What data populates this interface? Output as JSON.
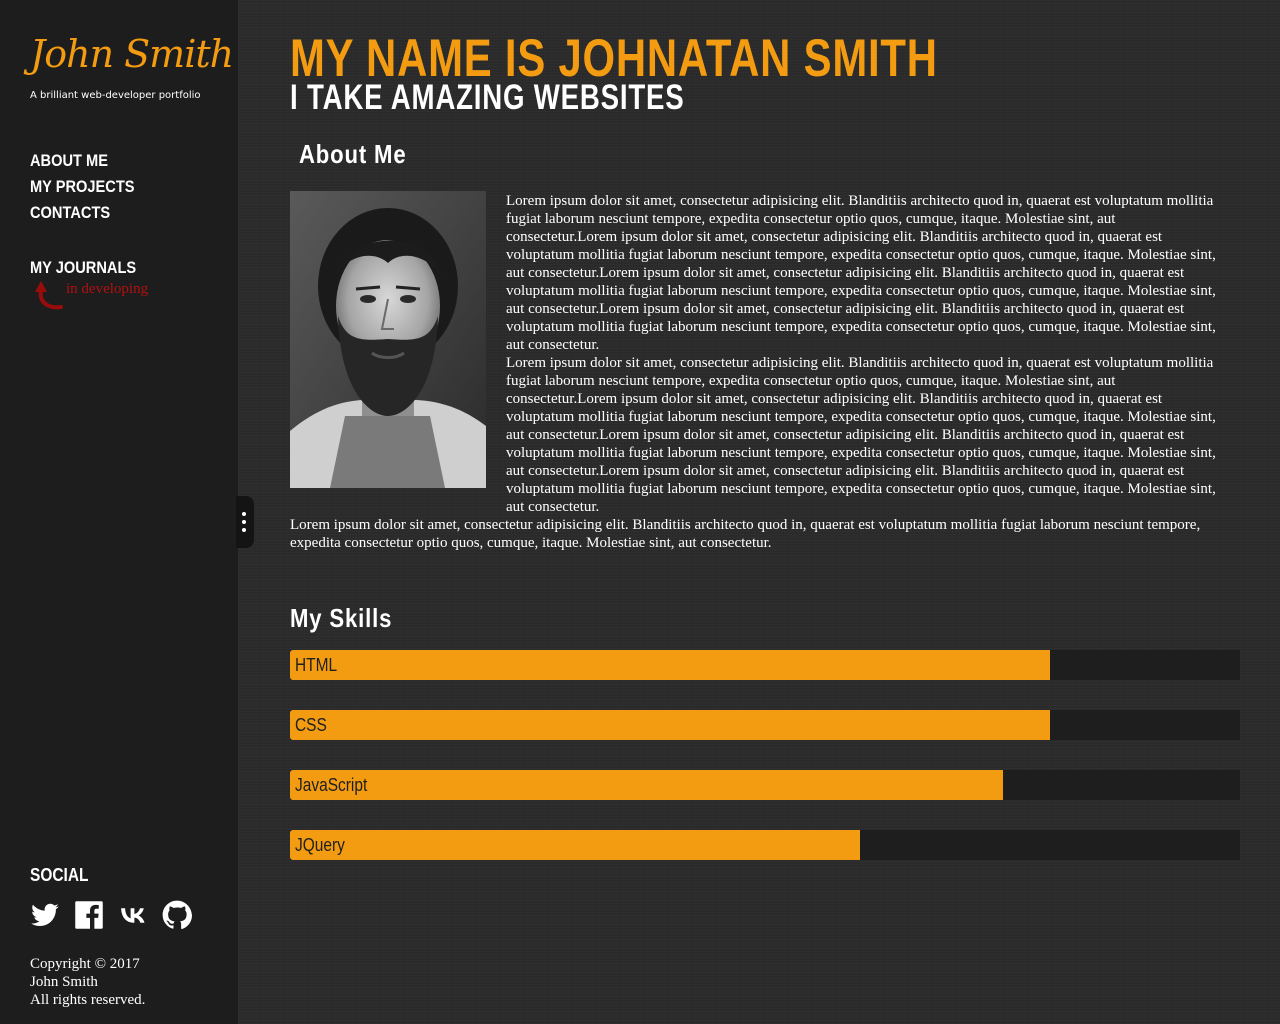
{
  "brand": {
    "logo": "John Smith",
    "tagline": "A brilliant web-developer portfolio"
  },
  "nav": {
    "items": [
      {
        "label": "ABOUT ME"
      },
      {
        "label": "MY PROJECTS"
      },
      {
        "label": "CONTACTS"
      }
    ],
    "journals": "MY JOURNALS",
    "journals_note": "in developing"
  },
  "social": {
    "title": "SOCIAL",
    "icons": [
      "twitter-icon",
      "facebook-icon",
      "vk-icon",
      "github-icon"
    ]
  },
  "copyright": {
    "line1": "Copyright © 2017",
    "line2": "John Smith",
    "line3": "All rights reserved."
  },
  "header": {
    "title": "MY NAME IS JOHNATAN SMITH",
    "subtitle": "I TAKE AMAZING WEBSITES"
  },
  "about": {
    "title": "About Me",
    "paragraphs": [
      "Lorem ipsum dolor sit amet, consectetur adipisicing elit. Blanditiis architecto quod in, quaerat est voluptatum mollitia fugiat laborum nesciunt tempore, expedita consectetur optio quos, cumque, itaque. Molestiae sint, aut consectetur.Lorem ipsum dolor sit amet, consectetur adipisicing elit. Blanditiis architecto quod in, quaerat est voluptatum mollitia fugiat laborum nesciunt tempore, expedita consectetur optio quos, cumque, itaque. Molestiae sint, aut consectetur.Lorem ipsum dolor sit amet, consectetur adipisicing elit. Blanditiis architecto quod in, quaerat est voluptatum mollitia fugiat laborum nesciunt tempore, expedita consectetur optio quos, cumque, itaque. Molestiae sint, aut consectetur.Lorem ipsum dolor sit amet, consectetur adipisicing elit. Blanditiis architecto quod in, quaerat est voluptatum mollitia fugiat laborum nesciunt tempore, expedita consectetur optio quos, cumque, itaque. Molestiae sint, aut consectetur.",
      "Lorem ipsum dolor sit amet, consectetur adipisicing elit. Blanditiis architecto quod in, quaerat est voluptatum mollitia fugiat laborum nesciunt tempore, expedita consectetur optio quos, cumque, itaque. Molestiae sint, aut consectetur.Lorem ipsum dolor sit amet, consectetur adipisicing elit. Blanditiis architecto quod in, quaerat est voluptatum mollitia fugiat laborum nesciunt tempore, expedita consectetur optio quos, cumque, itaque. Molestiae sint, aut consectetur.Lorem ipsum dolor sit amet, consectetur adipisicing elit. Blanditiis architecto quod in, quaerat est voluptatum mollitia fugiat laborum nesciunt tempore, expedita consectetur optio quos, cumque, itaque. Molestiae sint, aut consectetur.Lorem ipsum dolor sit amet, consectetur adipisicing elit. Blanditiis architecto quod in, quaerat est voluptatum mollitia fugiat laborum nesciunt tempore, expedita consectetur optio quos, cumque, itaque. Molestiae sint, aut consectetur.",
      "Lorem ipsum dolor sit amet, consectetur adipisicing elit. Blanditiis architecto quod in, quaerat est voluptatum mollitia fugiat laborum nesciunt tempore, expedita consectetur optio quos, cumque, itaque. Molestiae sint, aut consectetur."
    ]
  },
  "skills": {
    "title": "My Skills",
    "items": [
      {
        "name": "HTML",
        "level": 0.8
      },
      {
        "name": "CSS",
        "level": 0.8
      },
      {
        "name": "JavaScript",
        "level": 0.75
      },
      {
        "name": "JQuery",
        "level": 0.6
      }
    ]
  },
  "colors": {
    "accent": "#f39c12",
    "sidebar_bg": "#1d1d1d",
    "note_red": "#b01010"
  }
}
